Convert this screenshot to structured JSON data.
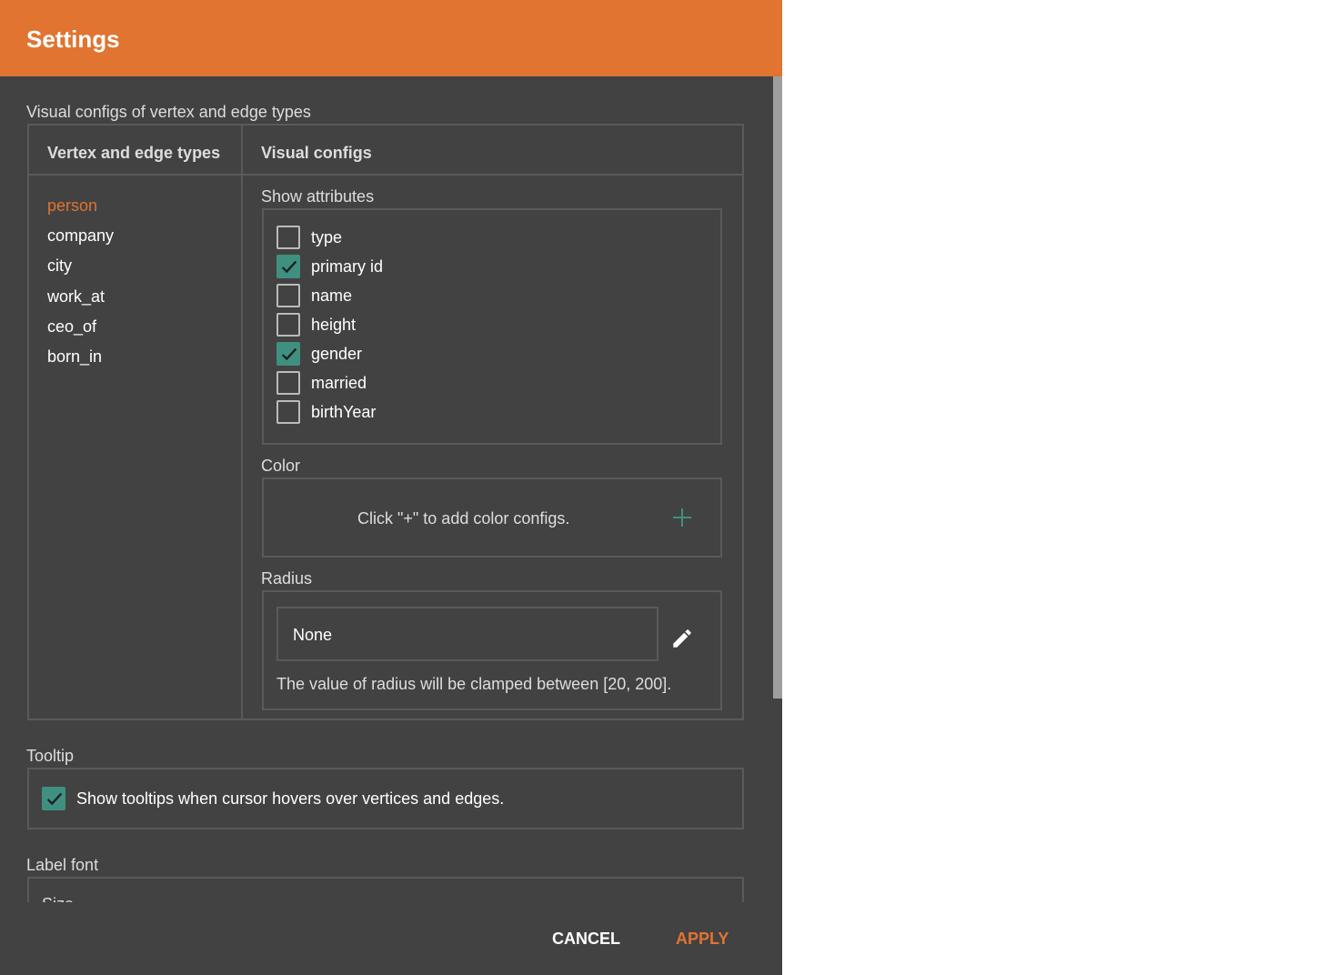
{
  "title": "Settings",
  "section_title": "Visual configs of vertex and edge types",
  "table": {
    "col1": "Vertex and edge types",
    "col2": "Visual configs",
    "types": [
      "person",
      "company",
      "city",
      "work_at",
      "ceo_of",
      "born_in"
    ],
    "selected": "person"
  },
  "show_attributes": {
    "label": "Show attributes",
    "items": [
      {
        "label": "type",
        "checked": false
      },
      {
        "label": "primary id",
        "checked": true
      },
      {
        "label": "name",
        "checked": false
      },
      {
        "label": "height",
        "checked": false
      },
      {
        "label": "gender",
        "checked": true
      },
      {
        "label": "married",
        "checked": false
      },
      {
        "label": "birthYear",
        "checked": false
      }
    ]
  },
  "color": {
    "label": "Color",
    "hint": "Click \"+\" to add color configs.",
    "add_icon": "plus-icon"
  },
  "radius": {
    "label": "Radius",
    "value": "None",
    "edit_icon": "pencil-icon",
    "hint": "The value of radius will be clamped between [20, 200]."
  },
  "tooltip": {
    "label": "Tooltip",
    "checkbox_label": "Show tooltips when cursor hovers over vertices and edges.",
    "checked": true
  },
  "label_font": {
    "label": "Label font",
    "size_label": "Size"
  },
  "footer": {
    "cancel": "CANCEL",
    "apply": "APPLY"
  },
  "colors": {
    "accent": "#E07430",
    "background": "#424242",
    "check": "#3F9080"
  }
}
